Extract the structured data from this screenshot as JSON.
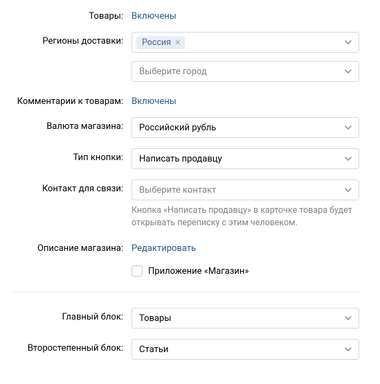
{
  "labels": {
    "products": "Товары:",
    "delivery_regions": "Регионы доставки:",
    "product_comments": "Комментарии к товарам:",
    "currency": "Валюта магазина:",
    "button_type": "Тип кнопки:",
    "contact": "Контакт для связи:",
    "description": "Описание магазина:",
    "main_block": "Главный блок:",
    "secondary_block": "Второстепенный блок:"
  },
  "values": {
    "products_status": "Включены",
    "region_tag": "Россия",
    "city_placeholder": "Выберите город",
    "comments_status": "Включены",
    "currency": "Российский рубль",
    "button_type": "Написать продавцу",
    "contact_placeholder": "Выберите контакт",
    "contact_hint": "Кнопка «Написать продавцу» в карточке товара будет открывать переписку с этим человеком.",
    "description_link": "Редактировать",
    "app_checkbox": "Приложение «Магазин»",
    "main_block": "Товары",
    "secondary_block": "Статьи"
  }
}
